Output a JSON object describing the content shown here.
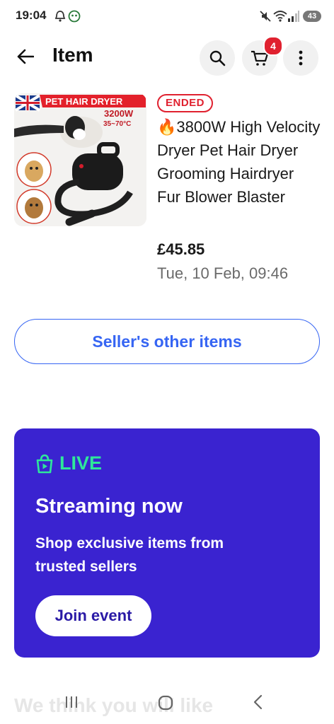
{
  "status_bar": {
    "time": "19:04",
    "battery": "43"
  },
  "app_bar": {
    "title": "Item"
  },
  "cart": {
    "count": "4"
  },
  "product": {
    "image_text": {
      "banner": "PET HAIR DRYER",
      "power": "3200W",
      "temp": "35~70°C"
    },
    "badge": "ENDED",
    "title_emoji": "🔥",
    "title": "3800W High Velocity Dryer Pet Hair Dryer Grooming Hairdryer Fur Blower Blaster",
    "price": "£45.85",
    "date": "Tue, 10 Feb, 09:46"
  },
  "seller_button": {
    "label": "Seller's other items"
  },
  "live_card": {
    "label": "LIVE",
    "heading": "Streaming now",
    "subtext": "Shop exclusive items from trusted sellers",
    "button": "Join event",
    "bg_color": "#3a23d0",
    "accent_color": "#2ee89a"
  },
  "recommend": {
    "heading": "We think you will like"
  },
  "colors": {
    "primary_blue": "#3665f3",
    "ended_red": "#e0212f"
  },
  "icons": [
    "back-arrow-icon",
    "search-icon",
    "cart-icon",
    "more-vert-icon",
    "live-bag-icon"
  ]
}
